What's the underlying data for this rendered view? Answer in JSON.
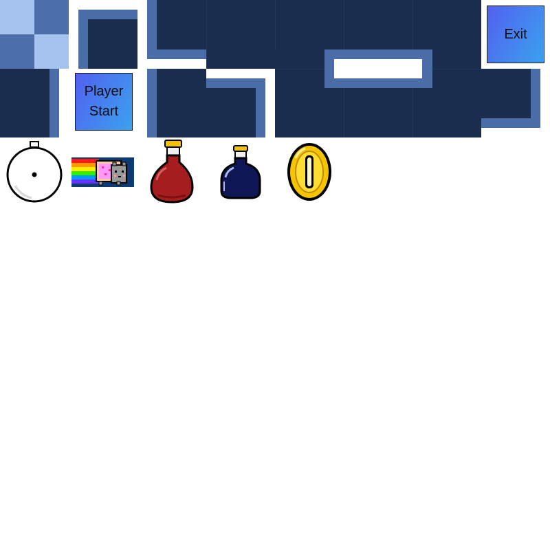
{
  "tiles": {
    "start_label_line1": "Player",
    "start_label_line2": "Start",
    "exit_label": "Exit"
  },
  "sprites": [
    {
      "name": "bomb-icon"
    },
    {
      "name": "nyan-cat-icon"
    },
    {
      "name": "red-potion-icon"
    },
    {
      "name": "blue-potion-icon"
    },
    {
      "name": "gold-coin-icon"
    }
  ],
  "colors": {
    "wall_dark": "#1b2d4f",
    "wall_border": "#4a6da8",
    "label_gradient_start": "#5260f0",
    "label_gradient_end": "#3aa2ee"
  }
}
